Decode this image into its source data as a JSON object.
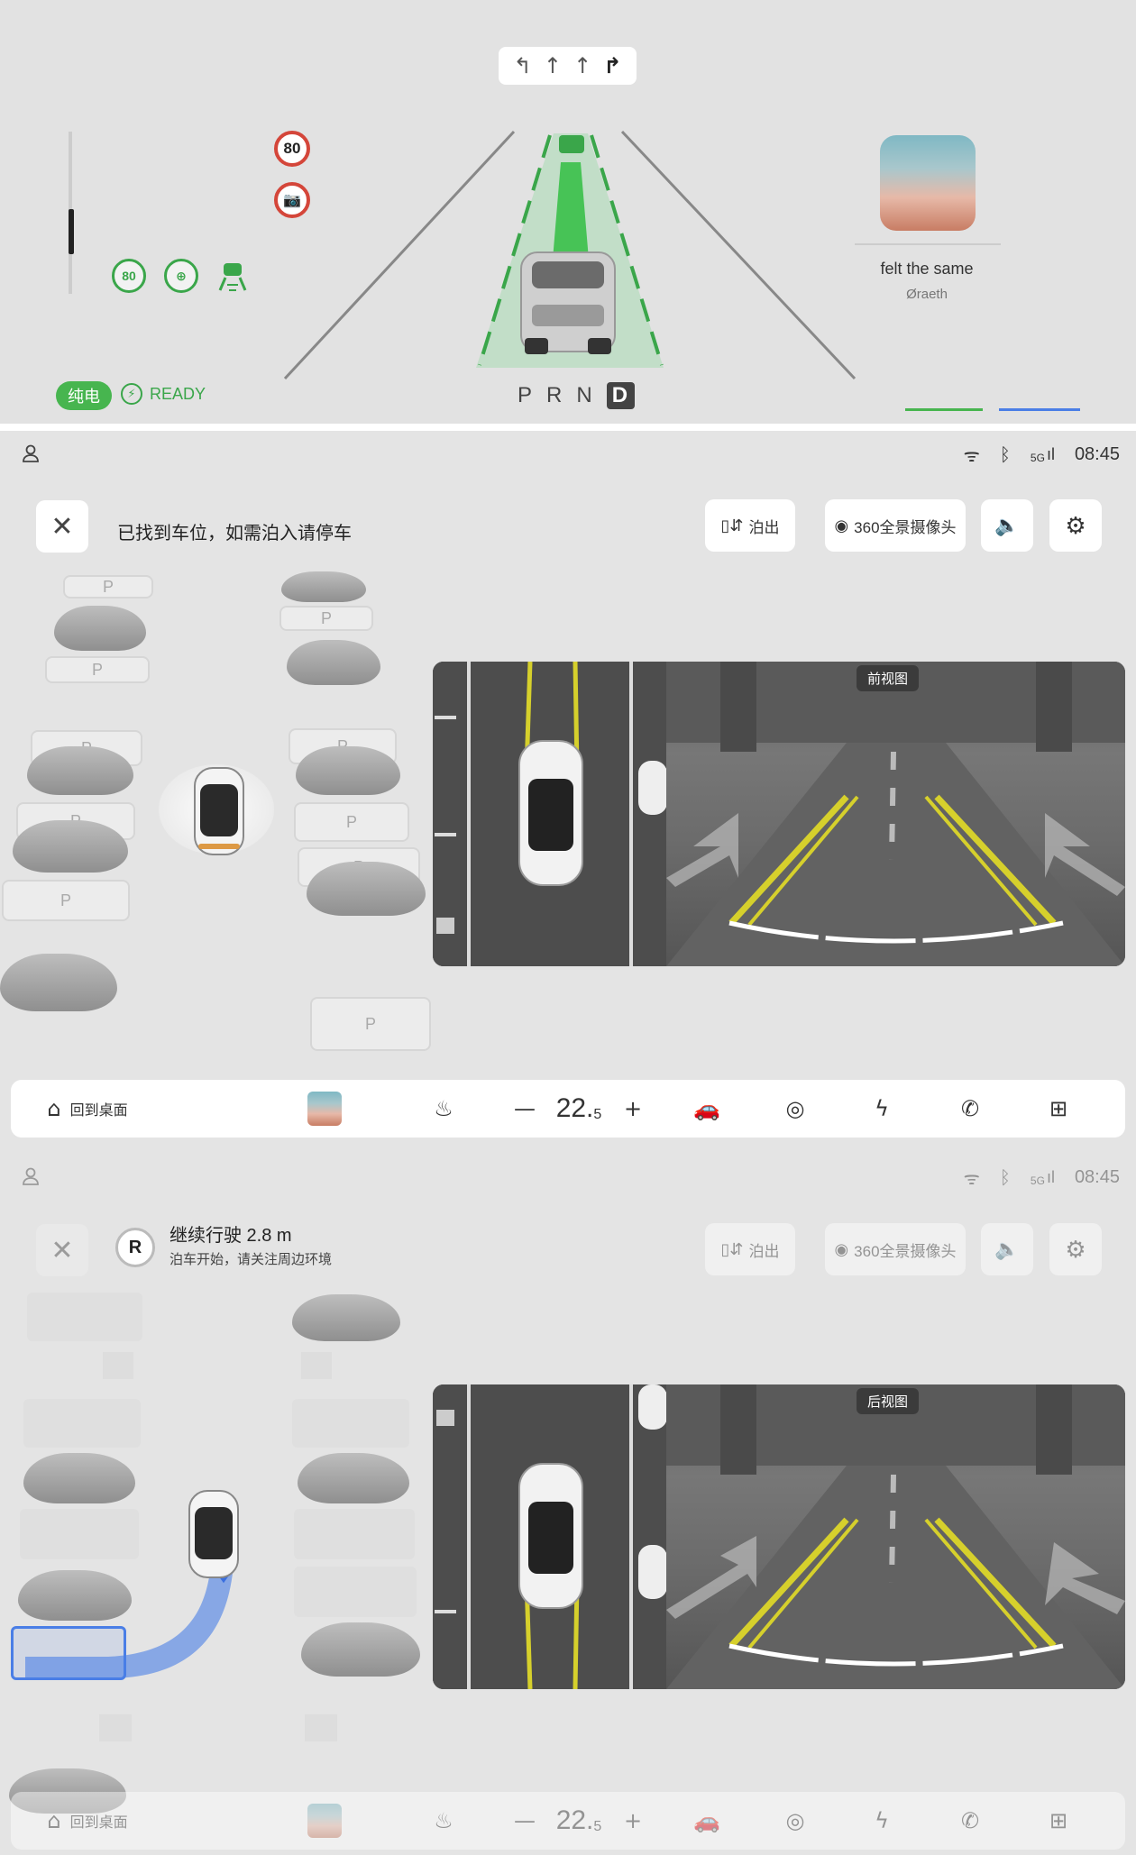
{
  "cluster": {
    "speed_limit": "80",
    "adas_speed": "80",
    "mode_label": "纯电",
    "ready_label": "READY",
    "gear_letters": [
      "P",
      "R",
      "N"
    ],
    "gear_active": "D",
    "song_title": "felt the same",
    "song_artist": "Øraeth"
  },
  "status_bar": {
    "time": "08:45",
    "signal_label": "5G"
  },
  "screen1": {
    "message": "已找到车位，如需泊入请停车",
    "park_out_label": "泊出",
    "camera360_label": "360全景摄像头",
    "view_label": "前视图"
  },
  "screen2": {
    "gear_badge": "R",
    "title": "继续行驶 2.8 m",
    "subtitle": "泊车开始，请关注周边环境",
    "park_out_label": "泊出",
    "camera360_label": "360全景摄像头",
    "view_label": "后视图"
  },
  "dock": {
    "home_label": "回到桌面",
    "temp_main": "22.",
    "temp_decimal": "5",
    "minus": "—",
    "plus": "+"
  },
  "slot_label": "P",
  "colors": {
    "green": "#47b54f",
    "blue_path": "#4a7ee6",
    "yellow_line": "#d6d02c"
  }
}
